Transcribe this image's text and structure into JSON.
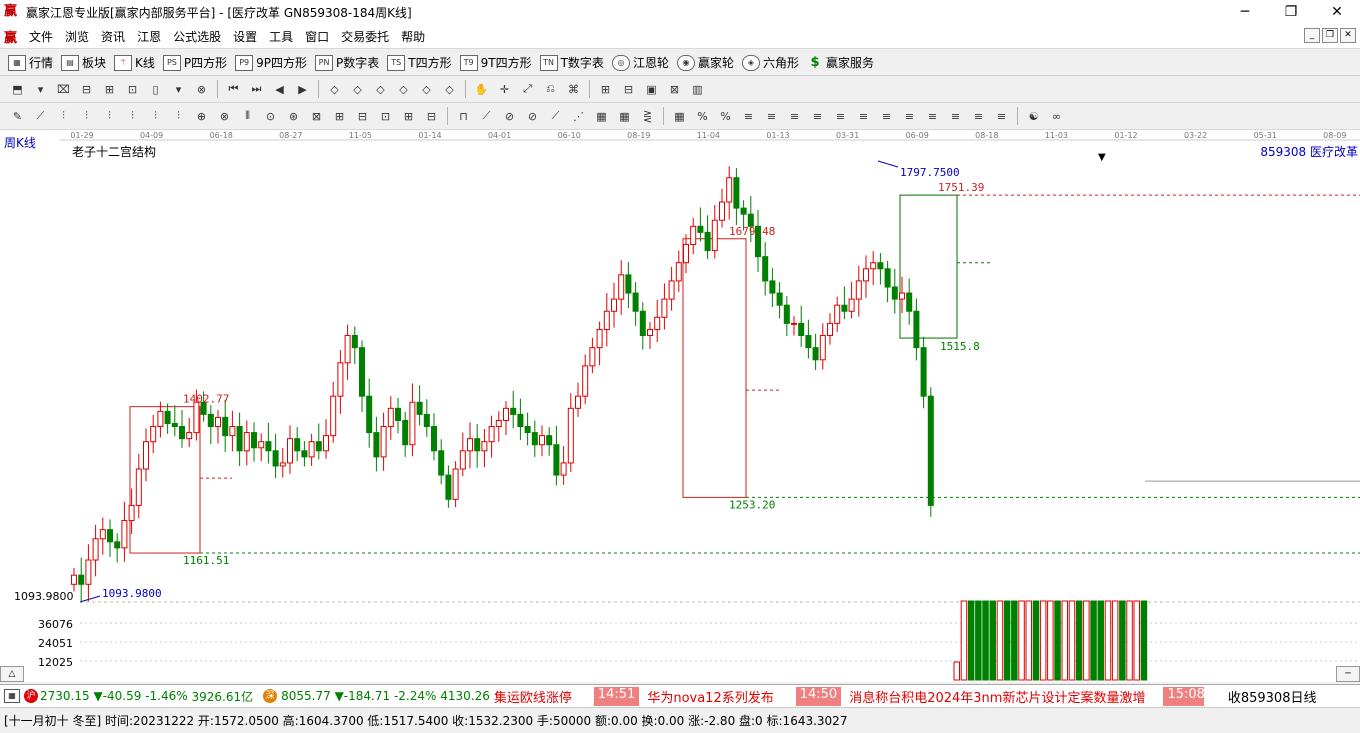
{
  "window": {
    "title": "赢家江恩专业版[赢家内部服务平台] - [医疗改革  GN859308-184周K线]",
    "logo": "赢",
    "min": "─",
    "max": "❐",
    "close": "✕"
  },
  "menu": {
    "logo": "赢",
    "items": [
      "文件",
      "浏览",
      "资讯",
      "江恩",
      "公式选股",
      "设置",
      "工具",
      "窗口",
      "交易委托",
      "帮助"
    ],
    "mdi": [
      "_",
      "❐",
      "✕"
    ]
  },
  "nav": [
    {
      "icon": "▦",
      "label": "行情"
    },
    {
      "icon": "▤",
      "label": "板块"
    },
    {
      "icon": "⚚",
      "label": "K线"
    },
    {
      "icon": "PS",
      "label": "P四方形"
    },
    {
      "icon": "P9",
      "label": "9P四方形"
    },
    {
      "icon": "PN",
      "label": "P数字表"
    },
    {
      "icon": "TS",
      "label": "T四方形"
    },
    {
      "icon": "T9",
      "label": "9T四方形"
    },
    {
      "icon": "TN",
      "label": "T数字表"
    },
    {
      "icon": "◎",
      "label": "江恩轮"
    },
    {
      "icon": "◉",
      "label": "赢家轮"
    },
    {
      "icon": "◈",
      "label": "六角形"
    },
    {
      "icon": "$",
      "label": "赢家服务"
    }
  ],
  "chart": {
    "period_label": "周K线",
    "indicator_name": "老子十二宫结构",
    "code_label": "859308  医疗改革",
    "price_axis_label": "1093.9800",
    "date_ticks": [
      "01-29",
      "04-09",
      "06-18",
      "08-27",
      "11-05",
      "01-14",
      "04-01",
      "06-10",
      "08-19",
      "11-04",
      "01-13",
      "03-31",
      "06-09",
      "08-18",
      "11-03",
      "01-12",
      "03-22",
      "05-31",
      "08-09"
    ],
    "box_labels": {
      "b1_high": "1402.77",
      "b1_low": "1161.51",
      "b2_high": "1679.48",
      "b2_low": "1253.20",
      "b3_high": "1751.39",
      "b3_low": "1515.8",
      "peak": "1797.7500",
      "trough": "1093.9800"
    },
    "volume_ticks": [
      "36076",
      "24051",
      "12025"
    ],
    "colors": {
      "up": "#e00000",
      "down": "#008000",
      "box_red": "#d02020",
      "box_green": "#007000"
    }
  },
  "status": {
    "idx1_value": "2730.15",
    "idx1_change": "▼-40.59",
    "idx1_pct": "-1.46%",
    "idx1_amount": "3926.61亿",
    "idx2_value": "8055.77",
    "idx2_change": "▼-184.71",
    "idx2_pct": "-2.24%",
    "idx2_amount": "4130.26",
    "news": [
      {
        "text": "集运欧线涨停",
        "time": "14:51"
      },
      {
        "text": "华为nova12系列发布",
        "time": "14:50"
      },
      {
        "text": "消息称台积电2024年3nm新芯片设计定案数量激增",
        "time": "15:08"
      }
    ],
    "right_label": "收859308日线"
  },
  "info": {
    "text": "[十一月初十 冬至] 时间:20231222 开:1572.0500 高:1604.3700 低:1517.5400 收:1532.2300 手:50000 额:0.00 换:0.00 涨:-2.80 盘:0 标:1643.3027"
  }
}
